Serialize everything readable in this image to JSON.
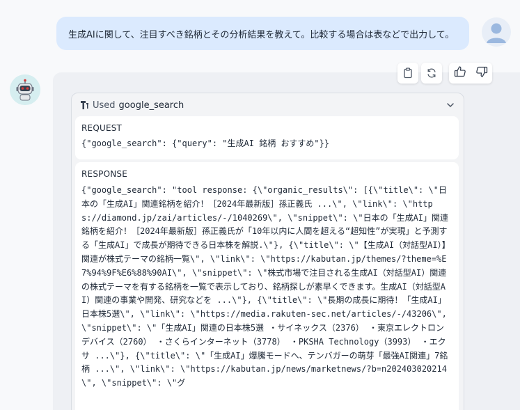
{
  "user_message": {
    "text": "生成AIに関して、注目すべき銘柄とその分析結果を教えて。比較する場合は表などで出力して。"
  },
  "icons": {
    "user_avatar": "user-avatar-icon",
    "bot_avatar": "robot-avatar-icon",
    "copy": "copy-icon",
    "regenerate": "refresh-icon",
    "thumbs_up": "thumbs-up-icon",
    "thumbs_down": "thumbs-down-icon",
    "tool": "tool-icon",
    "expand": "chevron-down-icon"
  },
  "tool_card": {
    "used_label": "Used",
    "tool_name": "google_search",
    "request": {
      "label": "REQUEST",
      "body": "{\"google_search\": {\"query\": \"生成AI 銘柄 おすすめ\"}}"
    },
    "response": {
      "label": "RESPONSE",
      "body": "{\"google_search\": \"tool response: {\\\"organic_results\\\": [{\\\"title\\\": \\\"日本の「生成AI」関連銘柄を紹介！［2024年最新版］孫正義氏 ...\\\", \\\"link\\\": \\\"https://diamond.jp/zai/articles/-/1040269\\\", \\\"snippet\\\": \\\"日本の「生成AI」関連銘柄を紹介！［2024年最新版］孫正義氏が「10年以内に人間を超える“超知性”が実現」と予測する「生成AI」で成長が期待できる日本株を解説.\\\"}, {\\\"title\\\": \\\"【生成AI（対話型AI）】関連が株式テーマの銘柄一覧\\\", \\\"link\\\": \\\"https://kabutan.jp/themes/?theme=%E7%94%9F%E6%88%90AI\\\", \\\"snippet\\\": \\\"株式市場で注目される生成AI（対話型AI）関連の株式テーマを有する銘柄を一覧で表示しており、銘柄探しが素早くできます。生成AI（対話型AI）関連の事業や開発、研究などを ...\\\"}, {\\\"title\\\": \\\"長期の成長に期待！「生成AI」日本株5選\\\", \\\"link\\\": \\\"https://media.rakuten-sec.net/articles/-/43206\\\", \\\"snippet\\\": \\\"「生成AI」関連の日本株5選 ・サイネックス（2376） ・東京エレクトロン デバイス（2760） ・さくらインターネット（3778） ・PKSHA Technology（3993） ・エクサ ...\\\"}, {\\\"title\\\": \\\"「生成AI」爆騰モードへ、テンバガーの萌芽「最強AI関連」7銘柄 ...\\\", \\\"link\\\": \\\"https://kabutan.jp/news/marketnews/?b=n202403020214\\\", \\\"snippet\\\": \\\"グ"
    }
  },
  "colors": {
    "user_bubble": "#dbeafe",
    "assistant_panel": "#eef0f4",
    "card_border": "#d9dde3",
    "bot_eyes": "#d63a3a"
  }
}
